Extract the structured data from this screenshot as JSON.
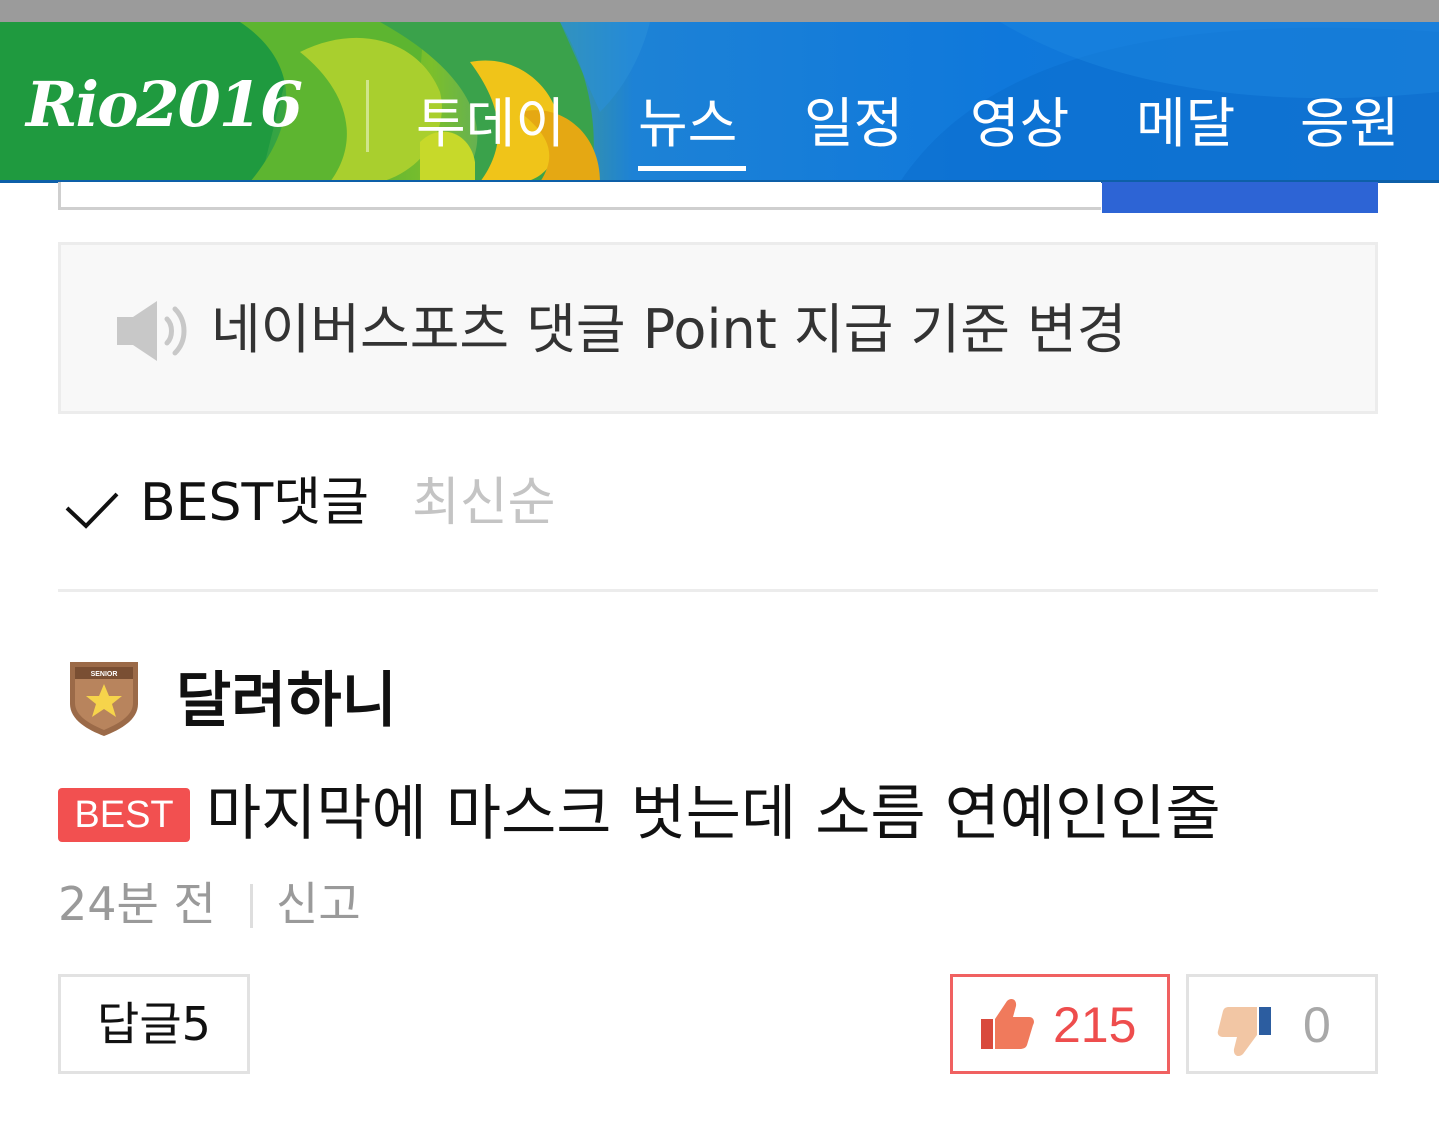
{
  "header": {
    "logo_text": "Rio2016",
    "nav": [
      {
        "label": "투데이",
        "active": false
      },
      {
        "label": "뉴스",
        "active": true
      },
      {
        "label": "일정",
        "active": false
      },
      {
        "label": "영상",
        "active": false
      },
      {
        "label": "메달",
        "active": false
      },
      {
        "label": "응원",
        "active": false
      }
    ]
  },
  "notice": {
    "icon": "speaker-icon",
    "text": "네이버스포츠 댓글 Point 지급 기준 변경"
  },
  "sort": {
    "best_label": "BEST댓글",
    "recent_label": "최신순",
    "selected": "BEST댓글"
  },
  "comment": {
    "author": "달려하니",
    "badge_icon": "senior-star-badge-icon",
    "badge_text": "SENIOR",
    "best_tag": "BEST",
    "text": "마지막에 마스크 벗는데 소름 연예인인줄",
    "time": "24분 전",
    "report_label": "신고",
    "reply_label": "답글",
    "reply_count": "5",
    "like_count": "215",
    "dislike_count": "0"
  },
  "colors": {
    "accent_blue": "#2d64d5",
    "best_red": "#f25050",
    "like_red": "#ee4d4d"
  }
}
